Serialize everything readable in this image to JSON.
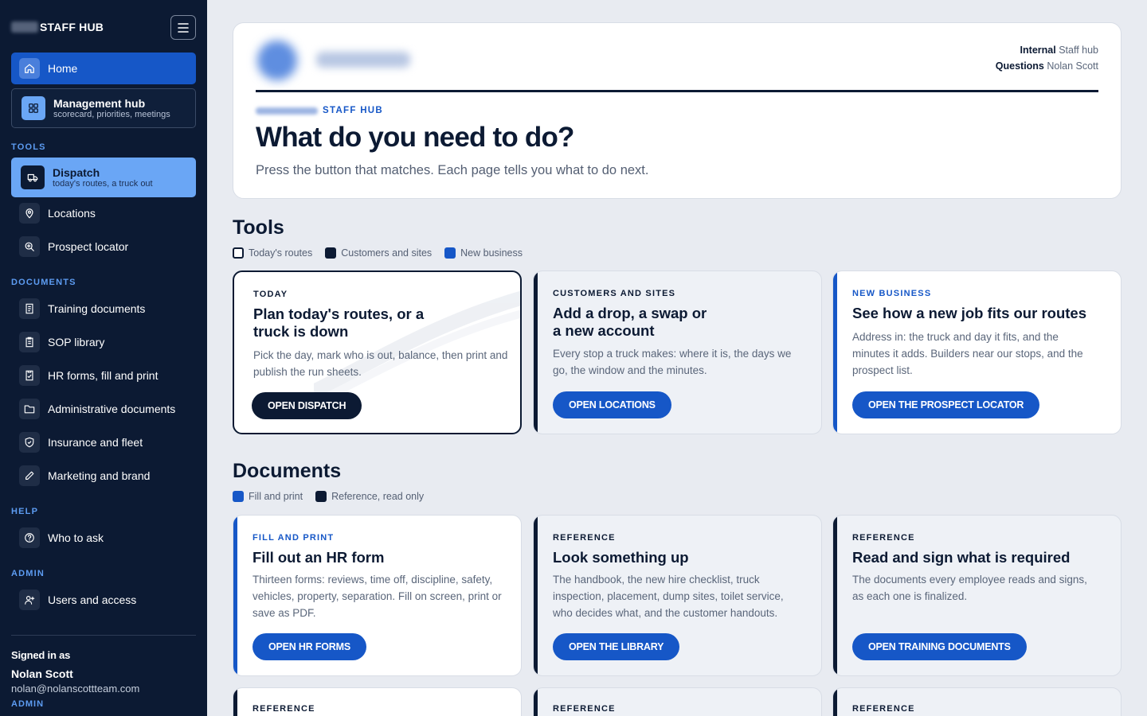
{
  "sidebar": {
    "brand": "STAFF HUB",
    "home": "Home",
    "management": {
      "title": "Management hub",
      "subtitle": "scorecard, priorities, meetings"
    },
    "tools_label": "TOOLS",
    "dispatch": {
      "title": "Dispatch",
      "subtitle": "today's routes, a truck out"
    },
    "locations": "Locations",
    "prospect": "Prospect locator",
    "documents_label": "DOCUMENTS",
    "training": "Training documents",
    "sop": "SOP library",
    "hr": "HR forms, fill and print",
    "admin_docs": "Administrative documents",
    "insurance": "Insurance and fleet",
    "marketing": "Marketing and brand",
    "help_label": "HELP",
    "who": "Who to ask",
    "admin_label": "ADMIN",
    "users": "Users and access",
    "signed_in_label": "Signed in as",
    "user_name": "Nolan Scott",
    "user_email": "nolan@nolanscottteam.com",
    "user_role": "ADMIN"
  },
  "hero": {
    "meta_internal_label": "Internal",
    "meta_internal_value": "Staff hub",
    "meta_questions_label": "Questions",
    "meta_questions_value": "Nolan Scott",
    "kicker": "STAFF HUB",
    "title": "What do you need to do?",
    "subtitle": "Press the button that matches. Each page tells you what to do next."
  },
  "tools": {
    "heading": "Tools",
    "legend": [
      "Today's routes",
      "Customers and sites",
      "New business"
    ],
    "cards": [
      {
        "kicker": "TODAY",
        "title": "Plan today's routes, or a truck is down",
        "desc": "Pick the day, mark who is out, balance, then print and publish the run sheets.",
        "button": "OPEN DISPATCH"
      },
      {
        "kicker": "CUSTOMERS AND SITES",
        "title": "Add a drop, a swap or a new account",
        "desc": "Every stop a truck makes: where it is, the days we go, the window and the minutes.",
        "button": "OPEN LOCATIONS"
      },
      {
        "kicker": "NEW BUSINESS",
        "title": "See how a new job fits our routes",
        "desc": "Address in: the truck and day it fits, and the minutes it adds. Builders near our stops, and the prospect list.",
        "button": "OPEN THE PROSPECT LOCATOR"
      }
    ]
  },
  "documents": {
    "heading": "Documents",
    "legend": [
      "Fill and print",
      "Reference, read only"
    ],
    "cards": [
      {
        "kicker": "FILL AND PRINT",
        "title": "Fill out an HR form",
        "desc": "Thirteen forms: reviews, time off, discipline, safety, vehicles, property, separation. Fill on screen, print or save as PDF.",
        "button": "OPEN HR FORMS"
      },
      {
        "kicker": "REFERENCE",
        "title": "Look something up",
        "desc": "The handbook, the new hire checklist, truck inspection, placement, dump sites, toilet service, who decides what, and the customer handouts.",
        "button": "OPEN THE LIBRARY"
      },
      {
        "kicker": "REFERENCE",
        "title": "Read and sign what is required",
        "desc": "The documents every employee reads and signs, as each one is finalized.",
        "button": "OPEN TRAINING DOCUMENTS"
      }
    ],
    "next_row_kickers": [
      "REFERENCE",
      "REFERENCE",
      "REFERENCE"
    ]
  },
  "colors": {
    "navy": "#0c1a33",
    "blue": "#1657c7",
    "light_blue": "#6aa6f5",
    "background": "#e8ebf1"
  }
}
